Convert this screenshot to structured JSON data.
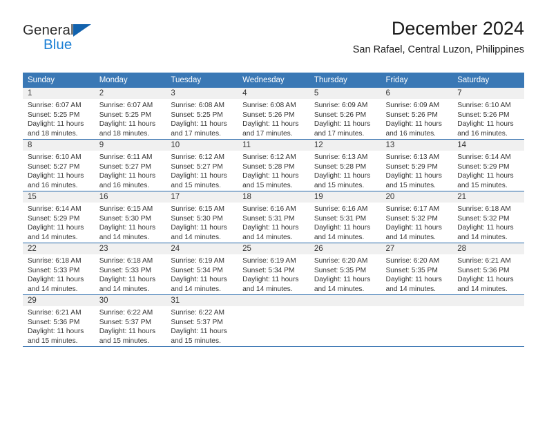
{
  "brand": {
    "name_part1": "General",
    "name_part2": "Blue",
    "triangle_icon": "triangle-icon",
    "accent_color": "#1b7fd4",
    "triangle_color": "#1262ad"
  },
  "header": {
    "title": "December 2024",
    "subtitle": "San Rafael, Central Luzon, Philippines"
  },
  "theme": {
    "header_bg": "#3a78b5",
    "header_text": "#ffffff",
    "daynum_band_bg": "#f0f0f0",
    "row_divider": "#1f63a8",
    "body_text": "#333333"
  },
  "calendar": {
    "weekday_headers": [
      "Sunday",
      "Monday",
      "Tuesday",
      "Wednesday",
      "Thursday",
      "Friday",
      "Saturday"
    ],
    "weeks": [
      [
        {
          "day": "1",
          "sunrise": "Sunrise: 6:07 AM",
          "sunset": "Sunset: 5:25 PM",
          "daylight": "Daylight: 11 hours and 18 minutes."
        },
        {
          "day": "2",
          "sunrise": "Sunrise: 6:07 AM",
          "sunset": "Sunset: 5:25 PM",
          "daylight": "Daylight: 11 hours and 18 minutes."
        },
        {
          "day": "3",
          "sunrise": "Sunrise: 6:08 AM",
          "sunset": "Sunset: 5:25 PM",
          "daylight": "Daylight: 11 hours and 17 minutes."
        },
        {
          "day": "4",
          "sunrise": "Sunrise: 6:08 AM",
          "sunset": "Sunset: 5:26 PM",
          "daylight": "Daylight: 11 hours and 17 minutes."
        },
        {
          "day": "5",
          "sunrise": "Sunrise: 6:09 AM",
          "sunset": "Sunset: 5:26 PM",
          "daylight": "Daylight: 11 hours and 17 minutes."
        },
        {
          "day": "6",
          "sunrise": "Sunrise: 6:09 AM",
          "sunset": "Sunset: 5:26 PM",
          "daylight": "Daylight: 11 hours and 16 minutes."
        },
        {
          "day": "7",
          "sunrise": "Sunrise: 6:10 AM",
          "sunset": "Sunset: 5:26 PM",
          "daylight": "Daylight: 11 hours and 16 minutes."
        }
      ],
      [
        {
          "day": "8",
          "sunrise": "Sunrise: 6:10 AM",
          "sunset": "Sunset: 5:27 PM",
          "daylight": "Daylight: 11 hours and 16 minutes."
        },
        {
          "day": "9",
          "sunrise": "Sunrise: 6:11 AM",
          "sunset": "Sunset: 5:27 PM",
          "daylight": "Daylight: 11 hours and 16 minutes."
        },
        {
          "day": "10",
          "sunrise": "Sunrise: 6:12 AM",
          "sunset": "Sunset: 5:27 PM",
          "daylight": "Daylight: 11 hours and 15 minutes."
        },
        {
          "day": "11",
          "sunrise": "Sunrise: 6:12 AM",
          "sunset": "Sunset: 5:28 PM",
          "daylight": "Daylight: 11 hours and 15 minutes."
        },
        {
          "day": "12",
          "sunrise": "Sunrise: 6:13 AM",
          "sunset": "Sunset: 5:28 PM",
          "daylight": "Daylight: 11 hours and 15 minutes."
        },
        {
          "day": "13",
          "sunrise": "Sunrise: 6:13 AM",
          "sunset": "Sunset: 5:29 PM",
          "daylight": "Daylight: 11 hours and 15 minutes."
        },
        {
          "day": "14",
          "sunrise": "Sunrise: 6:14 AM",
          "sunset": "Sunset: 5:29 PM",
          "daylight": "Daylight: 11 hours and 15 minutes."
        }
      ],
      [
        {
          "day": "15",
          "sunrise": "Sunrise: 6:14 AM",
          "sunset": "Sunset: 5:29 PM",
          "daylight": "Daylight: 11 hours and 14 minutes."
        },
        {
          "day": "16",
          "sunrise": "Sunrise: 6:15 AM",
          "sunset": "Sunset: 5:30 PM",
          "daylight": "Daylight: 11 hours and 14 minutes."
        },
        {
          "day": "17",
          "sunrise": "Sunrise: 6:15 AM",
          "sunset": "Sunset: 5:30 PM",
          "daylight": "Daylight: 11 hours and 14 minutes."
        },
        {
          "day": "18",
          "sunrise": "Sunrise: 6:16 AM",
          "sunset": "Sunset: 5:31 PM",
          "daylight": "Daylight: 11 hours and 14 minutes."
        },
        {
          "day": "19",
          "sunrise": "Sunrise: 6:16 AM",
          "sunset": "Sunset: 5:31 PM",
          "daylight": "Daylight: 11 hours and 14 minutes."
        },
        {
          "day": "20",
          "sunrise": "Sunrise: 6:17 AM",
          "sunset": "Sunset: 5:32 PM",
          "daylight": "Daylight: 11 hours and 14 minutes."
        },
        {
          "day": "21",
          "sunrise": "Sunrise: 6:18 AM",
          "sunset": "Sunset: 5:32 PM",
          "daylight": "Daylight: 11 hours and 14 minutes."
        }
      ],
      [
        {
          "day": "22",
          "sunrise": "Sunrise: 6:18 AM",
          "sunset": "Sunset: 5:33 PM",
          "daylight": "Daylight: 11 hours and 14 minutes."
        },
        {
          "day": "23",
          "sunrise": "Sunrise: 6:18 AM",
          "sunset": "Sunset: 5:33 PM",
          "daylight": "Daylight: 11 hours and 14 minutes."
        },
        {
          "day": "24",
          "sunrise": "Sunrise: 6:19 AM",
          "sunset": "Sunset: 5:34 PM",
          "daylight": "Daylight: 11 hours and 14 minutes."
        },
        {
          "day": "25",
          "sunrise": "Sunrise: 6:19 AM",
          "sunset": "Sunset: 5:34 PM",
          "daylight": "Daylight: 11 hours and 14 minutes."
        },
        {
          "day": "26",
          "sunrise": "Sunrise: 6:20 AM",
          "sunset": "Sunset: 5:35 PM",
          "daylight": "Daylight: 11 hours and 14 minutes."
        },
        {
          "day": "27",
          "sunrise": "Sunrise: 6:20 AM",
          "sunset": "Sunset: 5:35 PM",
          "daylight": "Daylight: 11 hours and 14 minutes."
        },
        {
          "day": "28",
          "sunrise": "Sunrise: 6:21 AM",
          "sunset": "Sunset: 5:36 PM",
          "daylight": "Daylight: 11 hours and 14 minutes."
        }
      ],
      [
        {
          "day": "29",
          "sunrise": "Sunrise: 6:21 AM",
          "sunset": "Sunset: 5:36 PM",
          "daylight": "Daylight: 11 hours and 15 minutes."
        },
        {
          "day": "30",
          "sunrise": "Sunrise: 6:22 AM",
          "sunset": "Sunset: 5:37 PM",
          "daylight": "Daylight: 11 hours and 15 minutes."
        },
        {
          "day": "31",
          "sunrise": "Sunrise: 6:22 AM",
          "sunset": "Sunset: 5:37 PM",
          "daylight": "Daylight: 11 hours and 15 minutes."
        },
        {
          "day": "",
          "sunrise": "",
          "sunset": "",
          "daylight": ""
        },
        {
          "day": "",
          "sunrise": "",
          "sunset": "",
          "daylight": ""
        },
        {
          "day": "",
          "sunrise": "",
          "sunset": "",
          "daylight": ""
        },
        {
          "day": "",
          "sunrise": "",
          "sunset": "",
          "daylight": ""
        }
      ]
    ]
  }
}
